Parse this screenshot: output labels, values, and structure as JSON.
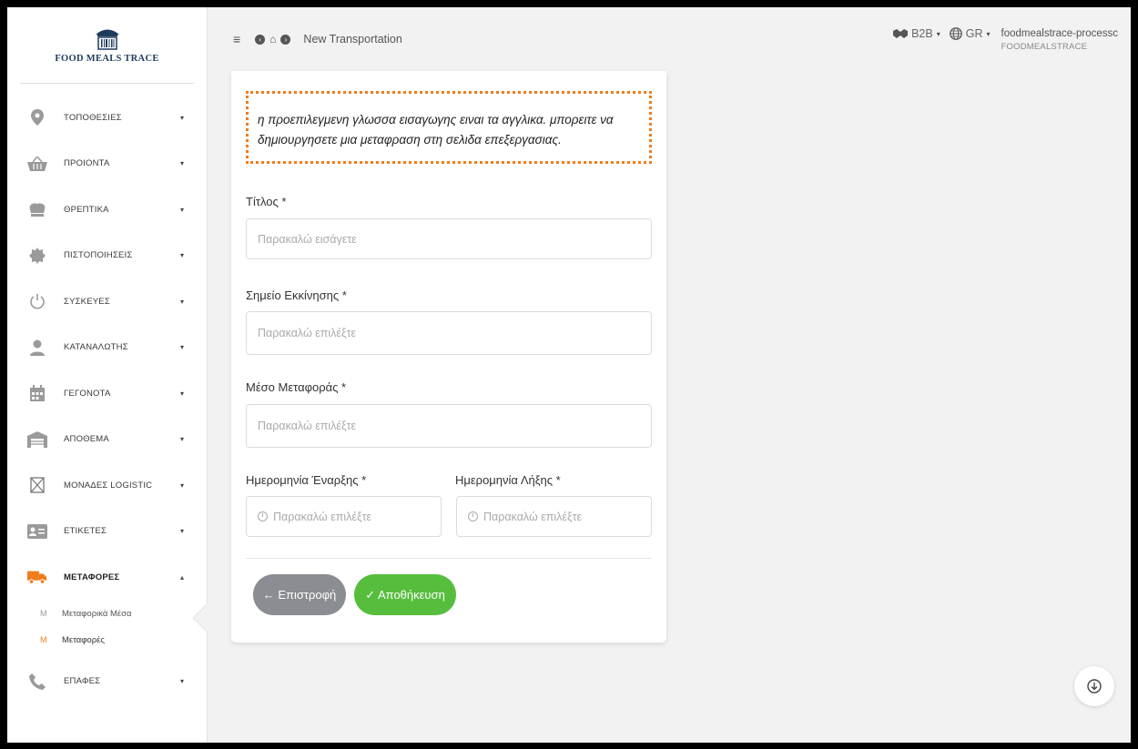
{
  "brand": {
    "name": "FOOD MEALS TRACE"
  },
  "header": {
    "title": "New Transportation",
    "b2b_label": "B2B",
    "lang_label": "GR",
    "user_name": "foodmealstrace-processc",
    "user_org": "FOODMEALSTRACE"
  },
  "sidebar": {
    "items": [
      {
        "label": "ΤΟΠΟΘΕΣΙΕΣ",
        "icon": "location-pin-icon",
        "caret": "▾"
      },
      {
        "label": "ΠΡΟΙΟΝΤΑ",
        "icon": "basket-icon",
        "caret": "▾"
      },
      {
        "label": "ΘΡΕΠΤΙΚΑ",
        "icon": "chef-hat-icon",
        "caret": "▾"
      },
      {
        "label": "ΠΙΣΤΟΠΟΙΗΣΕΙΣ",
        "icon": "certificate-seal-icon",
        "caret": "▾"
      },
      {
        "label": "ΣΥΣΚΕΥΕΣ",
        "icon": "power-icon",
        "caret": "▾"
      },
      {
        "label": "ΚΑΤΑΝΑΛΩΤΗΣ",
        "icon": "user-icon",
        "caret": "▾"
      },
      {
        "label": "ΓΕΓΟΝΟΤΑ",
        "icon": "calendar-icon",
        "caret": "▾"
      },
      {
        "label": "ΑΠΟΘΕΜΑ",
        "icon": "warehouse-icon",
        "caret": "▾"
      },
      {
        "label": "ΜΟΝΑΔΕΣ LOGISTIC",
        "icon": "box-icon",
        "caret": "▾"
      },
      {
        "label": "ΕΤΙΚΕΤΕΣ",
        "icon": "id-card-icon",
        "caret": "▾"
      },
      {
        "label": "ΜΕΤΑΦΟΡΕΣ",
        "icon": "truck-icon",
        "caret": "▴"
      }
    ],
    "subitems": [
      {
        "marker": "M",
        "label": "Μεταφορικά Μέσα"
      },
      {
        "marker": "M",
        "label": "Μεταφορές"
      }
    ],
    "last_item": {
      "label": "ΕΠΑΦΕΣ",
      "icon": "phone-icon",
      "caret": "▾"
    }
  },
  "form": {
    "notice": "η προεπιλεγμενη γλωσσα εισαγωγης ειναι τα αγγλικα. μπορειτε να δημιουργησετε μια μεταφραση στη σελιδα επεξεργασιας.",
    "title_label": "Τίτλος *",
    "title_placeholder": "Παρακαλώ εισάγετε",
    "start_label": "Σημείο Εκκίνησης *",
    "start_placeholder": "Παρακαλώ επιλέξτε",
    "means_label": "Μέσο Μεταφοράς *",
    "means_placeholder": "Παρακαλώ επιλέξτε",
    "start_date_label": "Ημερομηνία Έναρξης *",
    "start_date_placeholder": "Παρακαλώ επιλέξτε",
    "end_date_label": "Ημερομηνία Λήξης *",
    "end_date_placeholder": "Παρακαλώ επιλέξτε",
    "back_label": "← Επιστροφή",
    "save_label": "✓ Αποθήκευση"
  },
  "colors": {
    "accent_orange": "#f07c1c",
    "save_green": "#56be3c",
    "back_gray": "#8a8d91"
  }
}
